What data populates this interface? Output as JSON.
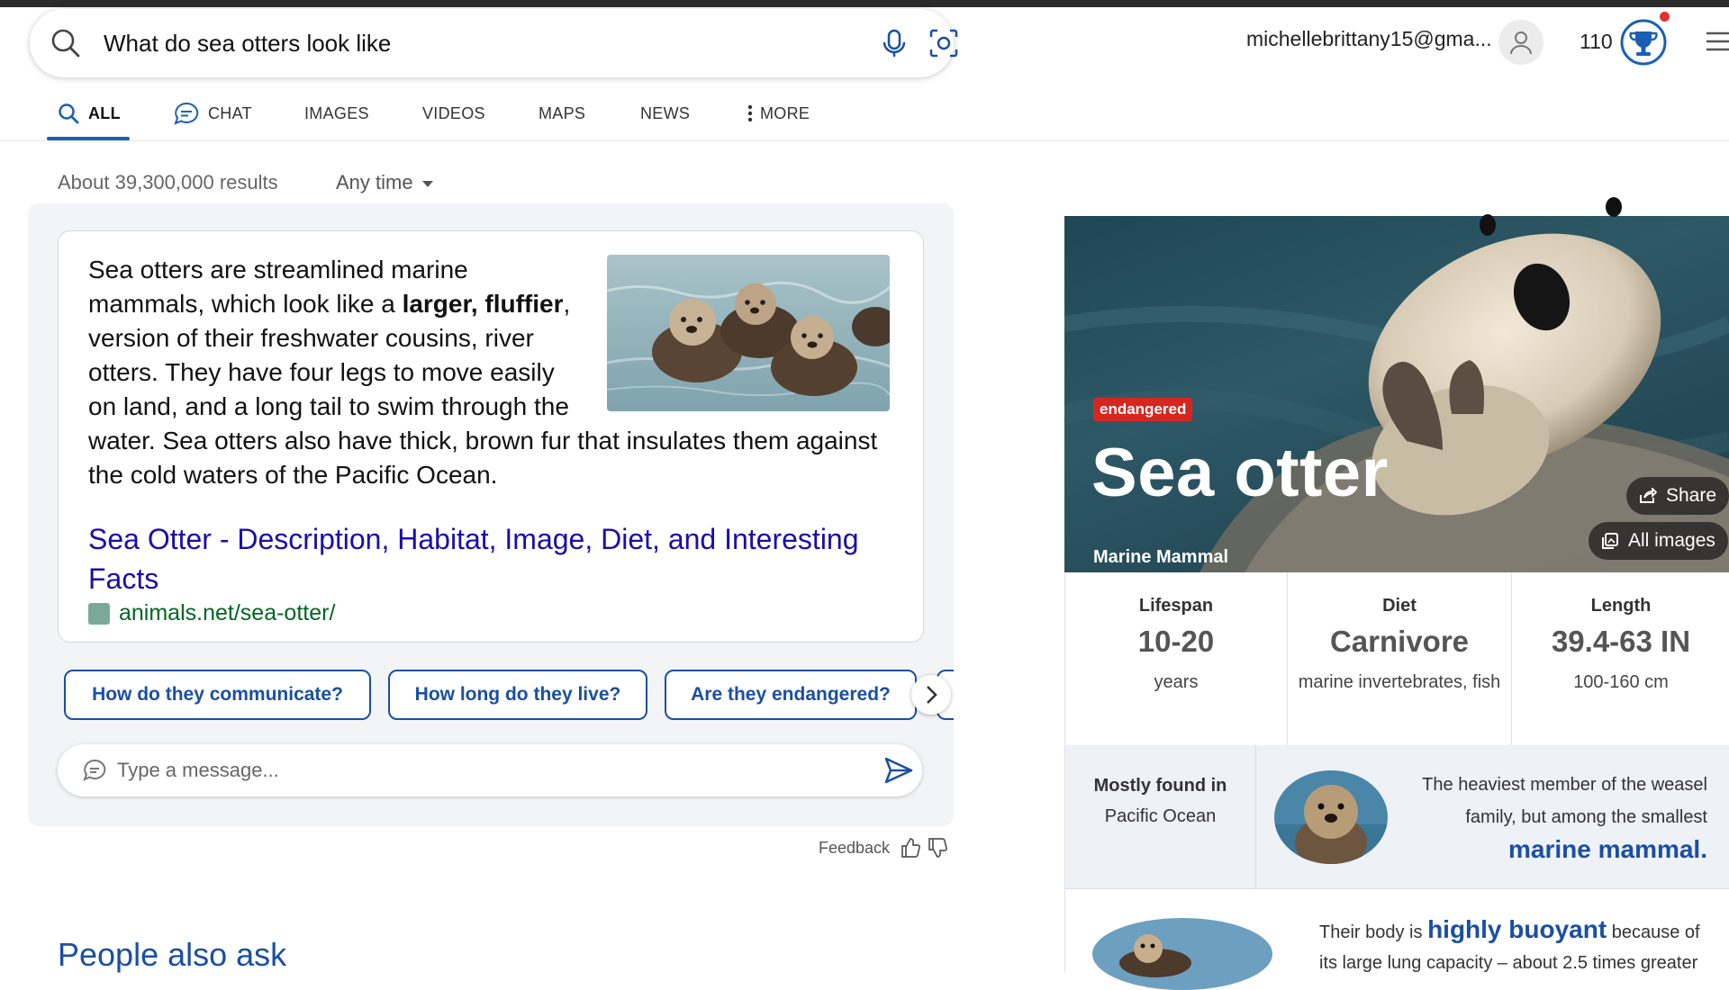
{
  "search": {
    "query": "What do sea otters look like"
  },
  "account": {
    "email": "michellebrittany15@gma...",
    "points": "110"
  },
  "tabs": [
    {
      "label": "ALL",
      "icon": "search-icon"
    },
    {
      "label": "CHAT",
      "icon": "chat-icon"
    },
    {
      "label": "IMAGES"
    },
    {
      "label": "VIDEOS"
    },
    {
      "label": "MAPS"
    },
    {
      "label": "NEWS"
    },
    {
      "label": "MORE",
      "icon": "more-vertical-icon"
    }
  ],
  "results": {
    "count": "About 39,300,000 results",
    "time_filter": "Any time"
  },
  "answer": {
    "text_before": "Sea otters are streamlined marine mammals, which look like a ",
    "text_bold": "larger, fluffier",
    "text_after": ", version of their freshwater cousins, river otters. They have four legs to move easily on land, and a long tail to swim through the water. Sea otters also have thick, brown fur that insulates them against the cold waters of the Pacific Ocean.",
    "link_title": "Sea Otter - Description, Habitat, Image, Diet, and Interesting Facts",
    "link_url": "animals.net/sea-otter/"
  },
  "suggestions": [
    "How do they communicate?",
    "How long do they live?",
    "Are they endangered?"
  ],
  "chat": {
    "placeholder": "Type a message..."
  },
  "feedback": {
    "label": "Feedback"
  },
  "people_also_ask": "People also ask",
  "knowledge_panel": {
    "badge": "endangered",
    "title": "Sea otter",
    "subtitle": "Marine Mammal",
    "share_label": "Share",
    "all_images_label": "All images",
    "facts": [
      {
        "label": "Lifespan",
        "value": "10-20",
        "sub": "years"
      },
      {
        "label": "Diet",
        "value": "Carnivore",
        "sub": "marine invertebrates, fish"
      },
      {
        "label": "Length",
        "value": "39.4-63 IN",
        "sub": "100-160 cm"
      }
    ],
    "found": {
      "label": "Mostly found in",
      "value": "Pacific Ocean",
      "fact_text": "The heaviest member of the weasel family, but among the smallest",
      "fact_highlight": "marine mammal."
    },
    "buoyancy": {
      "text_before": "Their body is ",
      "highlight": "highly buoyant",
      "text_after": " because of its large lung capacity – about 2.5 times greater"
    }
  },
  "colors": {
    "accent": "#1a4fa3",
    "link": "#1a0dab",
    "url": "#006621",
    "badge": "#d6261f"
  }
}
